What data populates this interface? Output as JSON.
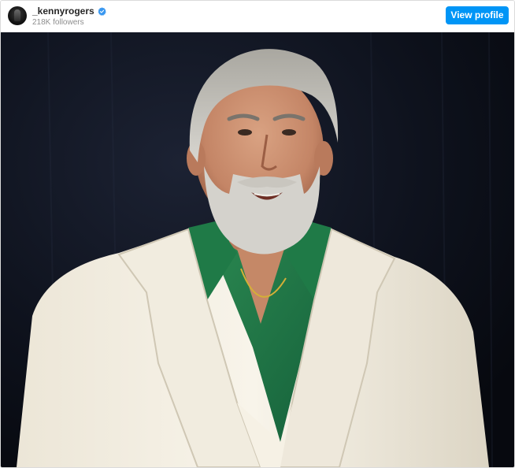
{
  "post": {
    "username": "_kennyrogers",
    "verified": true,
    "followers": "218K followers",
    "view_profile_label": "View profile"
  },
  "icons": {
    "avatar": "profile-avatar",
    "verified": "verified-badge-icon"
  },
  "colors": {
    "button_bg": "#0095f6",
    "button_text": "#ffffff",
    "verified_blue": "#3897f0",
    "photo_background": "#0b0e17"
  }
}
